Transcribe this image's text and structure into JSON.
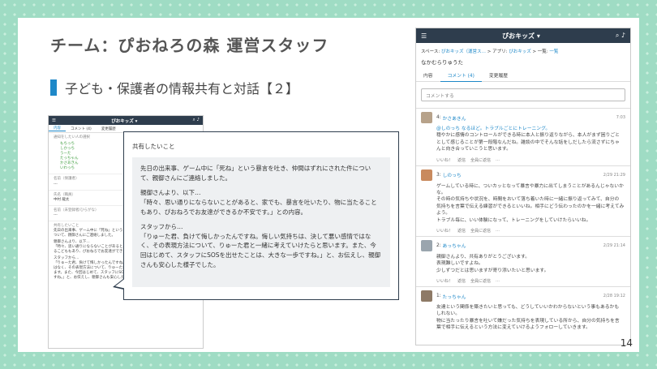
{
  "slide": {
    "title": "チーム：ぴおねろの森 運営スタッフ",
    "subtitle": "子ども・保護者の情報共有と対話【２】",
    "page": "14"
  },
  "left": {
    "app_title": "ぴおキッズ ▾",
    "tabs": [
      "内容",
      "コメント (4)",
      "変更履歴"
    ],
    "notify_label": "通知をしたい人の選択",
    "names": [
      "もちっち",
      "しかっち",
      "うーた",
      "たっちゃん",
      "かさあきん",
      "いわっち"
    ],
    "guardian_label": "名前（保護者）",
    "guardian_value": "---",
    "staff_label": "氏名（職員）",
    "staff_value": "中村 龍太",
    "child_label": "名前（未登録者/ひらがな）",
    "child_value": "---",
    "share_label": "共有したいこと",
    "lines": [
      "先日の出来事、ゲーム中に「死ね」という",
      "ついて、親御さんにご連絡しました。",
      "親御さんより、以下…",
      "「時々、思い通りにならないことがあると、家でも、暴言を吐いたり、物に当た",
      "るこどももあり、ぴおねろでお友達ができるか不安です。」との内容。",
      "スタッフから…",
      "「りゅーた君、負けて悔しかったんですね。悔しい気持ちは、決して悪い感情",
      "はなく、その表現方法について、りゅーた君と一緒に考えていけたらと思い",
      "ます。また、今回はじめて、スタッフにSOSを出せたことは、大きな一歩で",
      "すね。」と、お伝えし、親御さんも安心した様子でした。"
    ]
  },
  "bubble": {
    "heading": "共有したいこと",
    "p1": "先日の出来事、ゲーム中に「死ね」という暴言を吐き、仲間はずれにされた件について、親御さんにご連絡しました。",
    "p2": "親御さんより、以下…\n「時々、思い通りにならないことがあると、家でも、暴言を吐いたり、物に当たることもあり、ぴおねろでお友達ができるか不安です。」との内容。",
    "p3": "スタッフから…\n「りゅーた君、負けて悔しかったんですね。悔しい気持ちは、決して悪い感情ではなく、その表現方法について、りゅーた君と一緒に考えていけたらと思います。また、今回はじめて、スタッフにSOSを出せたことは、大きな一歩ですね。」と、お伝えし、親御さんも安心した様子でした。"
  },
  "right": {
    "app_title": "ぴおキッズ ▾",
    "crumb_prefix": "スペース:",
    "crumb_space": "ぴおキッズ（運営ス…",
    "crumb_app_prefix": "> アプリ:",
    "crumb_app": "ぴおキッズ",
    "crumb_list_prefix": "> 一覧:",
    "crumb_list": "一覧",
    "record_name": "なかむらりゅうた",
    "tabs": [
      "内容",
      "コメント (4)",
      "変更履歴"
    ],
    "comment_placeholder": "コメントする",
    "comments": [
      {
        "num": "4:",
        "name": "かさあきん",
        "date": "7:03",
        "text": [
          "@しのっち なるほど。トラブルごとにトレーニング。",
          "穏やかに感情のコントロールができる時に本人と振り返りながら、本人がまず困りごと",
          "として感じることが第一段階なんだね。雑談の中でそんな話をしだしたら流さずにちゃ",
          "んと向き合っていこうと思います。"
        ],
        "actions": [
          "いいね！",
          "返信",
          "全員に返信",
          "…"
        ]
      },
      {
        "num": "3:",
        "name": "しのっち",
        "date": "2/29 21:29",
        "text": [
          "ゲームしている時に、ついカッとなって暴言や暴力に出てしまうことがあるんじゃないかな。",
          "その時の気持ちや状況を、時間をおいて落ち着いた時に一緒に振り返ってみて、自分の",
          "気持ちを言葉で伝える練習ができるといいね。相手にどう伝わったのかを一緒に考えてみよう。",
          "トラブル毎に、いい体験になって、トレーニングをしていけたらいいね。"
        ],
        "actions": [
          "いいね！",
          "返信",
          "全員に返信",
          "…"
        ]
      },
      {
        "num": "2:",
        "name": "あっちゃん",
        "date": "2/29 21:14",
        "text": [
          "親御さんより、共有ありがとうございます。",
          "表現難しいですよね。",
          "少しずつだとは思いますが寄り添いたいと思います。"
        ],
        "actions": [
          "いいね！",
          "返信",
          "全員に返信",
          "…"
        ]
      },
      {
        "num": "1:",
        "name": "たっちゃん",
        "date": "2/28 19:12",
        "text": [
          "友達という関係を築きたいと思っても、どうしていいかわからないという事もあるかも",
          "しれない。",
          "物に当たったり暴言を吐いて嫌だった気持ちを表現している所から、自分の気持ちを言",
          "葉で相手に伝えるという方法に変えていけるようフォローしていきます。"
        ],
        "actions": []
      }
    ]
  }
}
